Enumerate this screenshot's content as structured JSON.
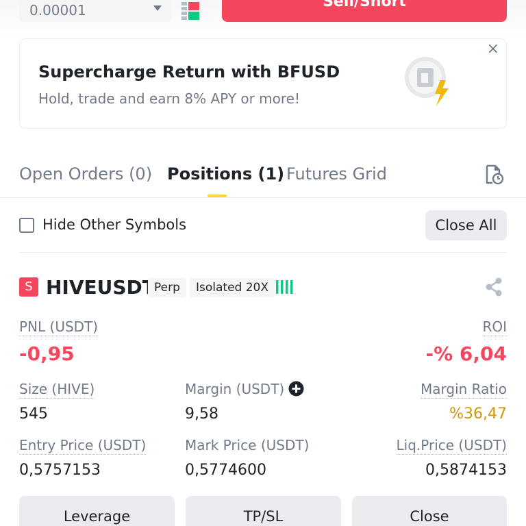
{
  "order_form": {
    "precision_value": "0.00001",
    "sell_button_label": "Sell/Short"
  },
  "promo": {
    "title": "Supercharge Return with BFUSD",
    "subtitle": "Hold, trade and earn 8% APY or more!",
    "close_glyph": "×"
  },
  "tabs": [
    {
      "label": "Open Orders (0)",
      "active": false
    },
    {
      "label": "Positions (1)",
      "active": true
    },
    {
      "label": "Futures Grid",
      "active": false
    }
  ],
  "filter": {
    "hide_label": "Hide Other Symbols",
    "hide_checked": false,
    "close_all_label": "Close All"
  },
  "position": {
    "side_badge": "S",
    "symbol": "HIVEUSDT",
    "type_tag": "Perp",
    "margin_mode_tag": "Isolated 20X",
    "pnl_label": "PNL (USDT)",
    "pnl_value": "-0,95",
    "roi_label": "ROI",
    "roi_value": "-% 6,04",
    "size_label": "Size (HIVE)",
    "size_value": "545",
    "margin_label": "Margin (USDT)",
    "margin_value": "9,58",
    "margin_ratio_label": "Margin Ratio",
    "margin_ratio_value": "%36,47",
    "entry_price_label": "Entry Price (USDT)",
    "entry_price_value": "0,5757153",
    "mark_price_label": "Mark Price (USDT)",
    "mark_price_value": "0,5774600",
    "liq_price_label": "Liq.Price (USDT)",
    "liq_price_value": "0,5874153"
  },
  "actions": {
    "leverage_label": "Leverage",
    "tpsl_label": "TP/SL",
    "close_label": "Close"
  },
  "colors": {
    "sell": "#f6465d",
    "accent": "#fcd535",
    "warning": "#d0980b",
    "up": "#0ecb81"
  },
  "icons": [
    "order-book-icon",
    "bfusd-bolt-logo-icon",
    "history-icon",
    "risk-bars-icon",
    "share-icon",
    "plus-circle-icon"
  ]
}
